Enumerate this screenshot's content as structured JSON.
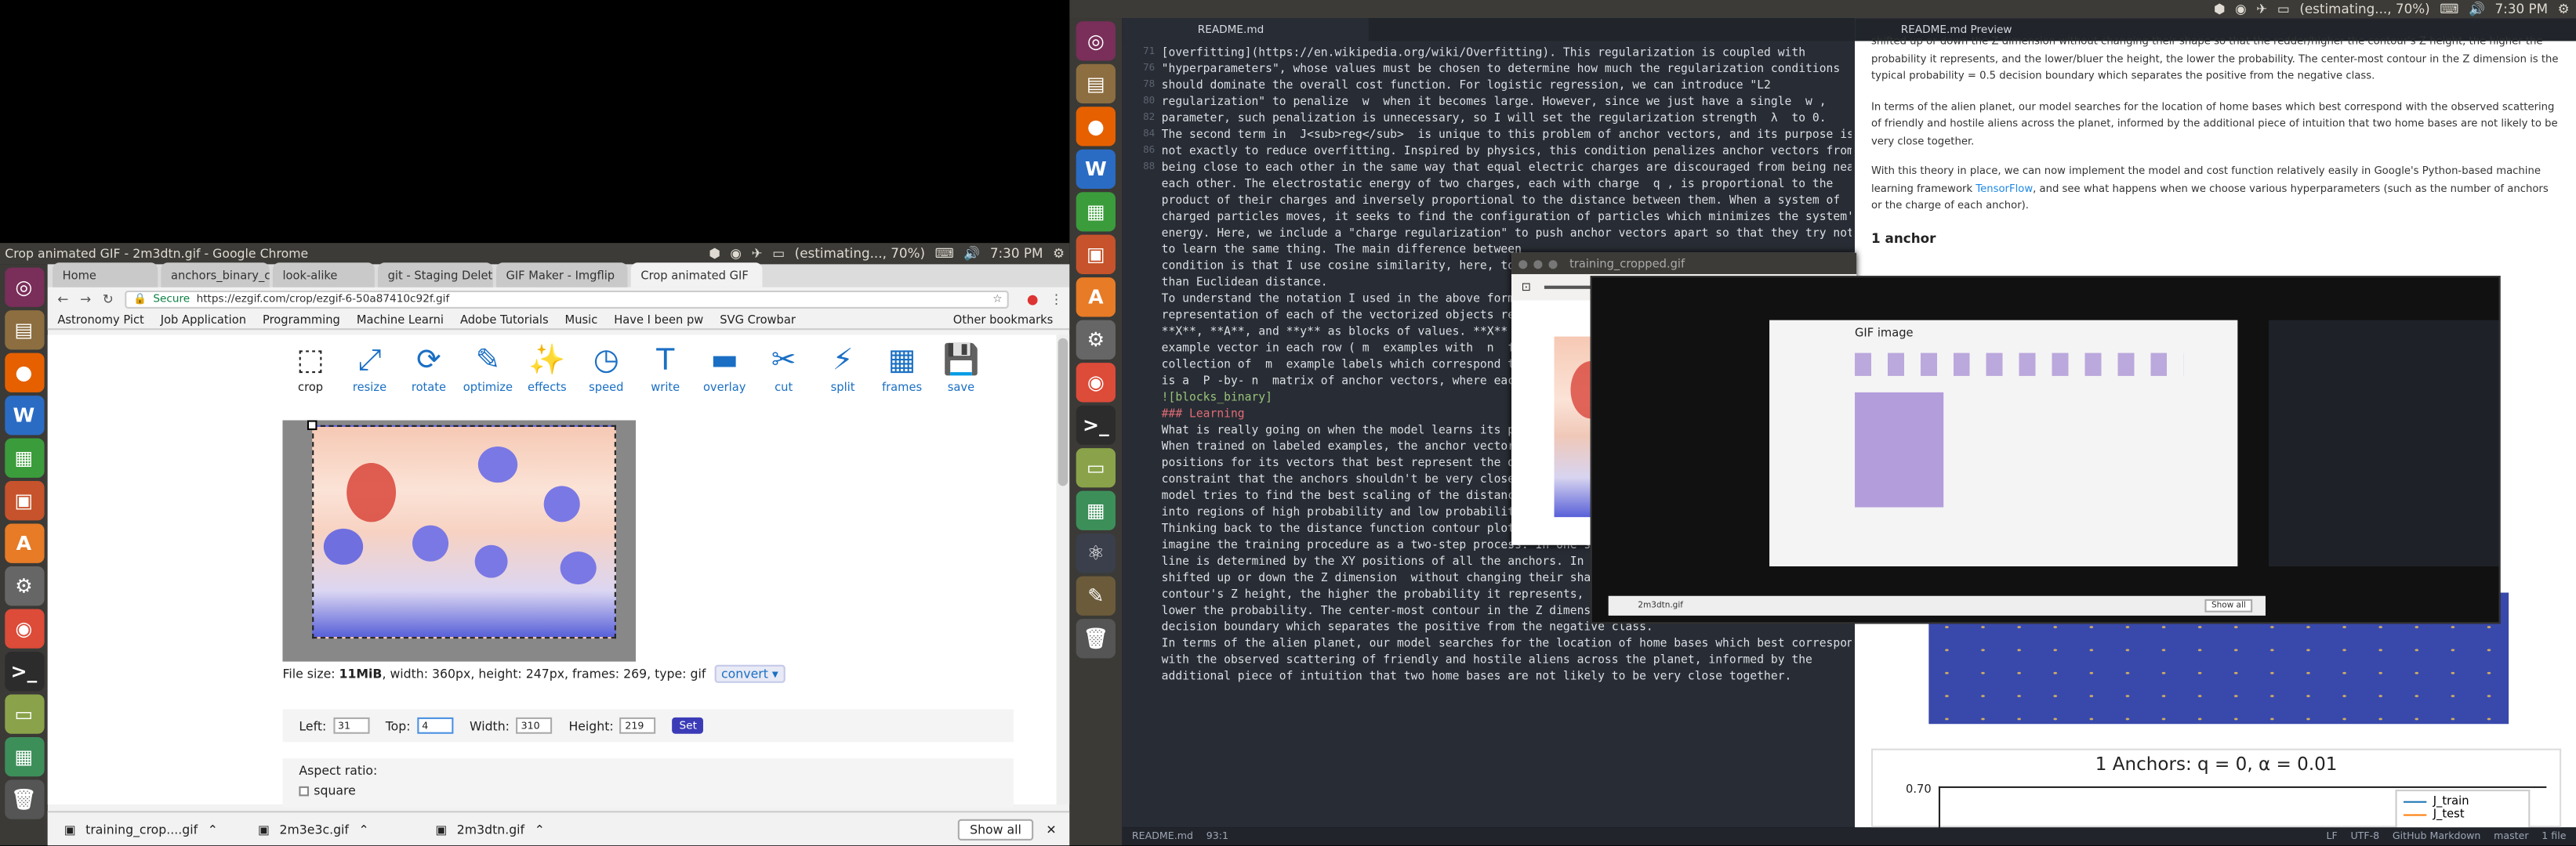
{
  "top_panel_right": {
    "status": "(estimating..., 70%)",
    "time": "7:30 PM"
  },
  "chrome": {
    "title": "Crop animated GIF - 2m3dtn.gif - Google Chrome",
    "tabs": [
      "Home",
      "anchors_binary_cla",
      "look-alike",
      "git - Staging Delete",
      "GIF Maker - Imgflip",
      "Crop animated GIF"
    ],
    "secure": "Secure",
    "url": "https://ezgif.com/crop/ezgif-6-50a87410c92f.gif",
    "bookmarks": [
      "Astronomy Pict",
      "Job Application",
      "Programming",
      "Machine Learni",
      "Adobe Tutorials",
      "Music",
      "Have I been pw",
      "SVG Crowbar",
      "Other bookmarks"
    ],
    "tools": [
      "crop",
      "resize",
      "rotate",
      "optimize",
      "effects",
      "speed",
      "write",
      "overlay",
      "cut",
      "split",
      "frames",
      "save"
    ],
    "file_info_prefix": "File size: ",
    "file_size": "11MiB",
    "file_info_rest": ", width: 360px, height: 247px, frames: 269, type: gif",
    "convert": "convert",
    "form": {
      "left_label": "Left:",
      "left": "31",
      "top_label": "Top:",
      "top": "4",
      "width_label": "Width:",
      "width": "310",
      "height_label": "Height:",
      "height": "219",
      "set": "Set"
    },
    "aspect": "Aspect ratio:",
    "square": "square",
    "downloads": [
      "training_crop....gif",
      "2m3e3c.gif",
      "2m3dtn.gif"
    ],
    "show_all": "Show all"
  },
  "editor": {
    "tab_md": "README.md",
    "tab_preview": "README.md Preview",
    "status_left": "README.md",
    "status_pos": "93:1",
    "status_right": [
      "LF",
      "UTF-8",
      "GitHub Markdown",
      "master",
      "1 file"
    ],
    "line_numbers": [
      "",
      "71",
      "",
      "",
      "",
      "",
      "",
      "",
      "",
      "",
      "76",
      "",
      "",
      "",
      "",
      "",
      "",
      "",
      "",
      "",
      "78",
      "",
      "",
      "",
      "",
      "",
      "",
      "80",
      "",
      "",
      "82",
      "",
      "",
      "84",
      "",
      "",
      "86",
      "",
      "",
      "",
      "",
      "",
      "",
      "",
      "",
      "88",
      "",
      "",
      "",
      "",
      "",
      "",
      "",
      "",
      "90",
      "",
      ""
    ],
    "lines": [
      "[overfitting](https://en.wikipedia.org/wiki/Overfitting). This regularization is coupled with",
      "\"hyperparameters\", whose values must be chosen to determine how much the regularization conditions",
      "should dominate the overall cost function. For logistic regression, we can introduce \"L2",
      "regularization\" to penalize  w  when it becomes large. However, since we just have a single  w ,",
      "parameter, such penalization is unnecessary, so I will set the regularization strength  λ  to 0.",
      "",
      "The second term in  J<sub>reg</sub>  is unique to this problem of anchor vectors, and its purpose is",
      "not exactly to reduce overfitting. Inspired by physics, this condition penalizes anchor vectors from",
      "being close to each other in the same way that equal electric charges are discouraged from being near",
      "each other. The electrostatic energy of two charges, each with charge  q , is proportional to the",
      "product of their charges and inversely proportional to the distance between them. When a system of",
      "charged particles moves, it seeks to find the configuration of particles which minimizes the system's",
      "energy. Here, we include a \"charge regularization\" to push anchor vectors apart so that they try not",
      "to learn the same thing. The main difference between",
      "condition is that I use cosine similarity, here, to",
      "than Euclidean distance.",
      "",
      "To understand the notation I used in the above formul",
      "representation of each of the vectorized objects refe",
      "**X**, **A**, and **y** as blocks of values. **X** is",
      "example vector in each row ( m  examples with  n  fea",
      "collection of  m  example labels which correspond to",
      "is a  P -by- n  matrix of anchor vectors, where each",
      "",
      "![blocks_binary]",
      "",
      "### Learning",
      "",
      "What is really going on when the model learns its par",
      "",
      "When trained on labeled examples, the anchor vector b",
      "positions for its vectors that best represent the distribution of",
      "constraint that the anchors shouldn't be very close together. The",
      "model tries to find the best scaling of the distance function out",
      "into regions of high probability and low probability for positive",
      "",
      "Thinking back to the distance function contour plots shown [above](#Distance Function), we can",
      "imagine the training procedure as a two-step process. In one step, the  shape  of every 2D contour",
      "line is determined by the XY positions of all the anchors. In the other step, the contour lines are",
      "shifted up or down the Z dimension  without changing their shape  so that the redder/higher the",
      "contour's Z height, the higher the probability it represents, and the lower/bluer the height, the",
      "lower the probability. The center-most contour in the Z dimension is the typical probability = 0.5",
      "decision boundary which separates the positive from the negative class.",
      "",
      "In terms of the alien planet, our model searches for the location of home bases which best correspond",
      "with the observed scattering of friendly and hostile aliens across the planet, informed by the",
      "additional piece of intuition that two home bases are not likely to be very close together."
    ],
    "preview_p1": "shifted up or down the Z dimension without changing their shape so that the redder/higher the contour's Z height, the higher the probability it represents, and the lower/bluer the height, the lower the probability. The center-most contour in the Z dimension is the typical probability = 0.5 decision boundary which separates the positive from the negative class.",
    "preview_p2": "In terms of the alien planet, our model searches for the location of home bases which best correspond with the observed scattering of friendly and hostile aliens across the planet, informed by the additional piece of intuition that two home bases are not likely to be very close together.",
    "preview_p3a": "With this theory in place, we can now implement the model and cost function relatively easily in Google's Python-based machine learning framework ",
    "preview_p3_link": "TensorFlow",
    "preview_p3b": ", and see what happens when we choose various hyperparameters (such as the number of anchors or the charge of each anchor).",
    "preview_h": "1 anchor",
    "preview_chart_title": "1 Anchors: q = 0, α = 0.01",
    "preview_chart_ytick": "0.70",
    "preview_legend": [
      "J_train",
      "J_test"
    ]
  },
  "viewer": {
    "title": "training_cropped.gif"
  },
  "nested": {
    "gif_image": "GIF image",
    "file": "2m3dtn.gif",
    "show_all": "Show all"
  },
  "colors": {
    "accent": "#1a6fc4",
    "editor_bg": "#282c34",
    "chrome_tab": "#f2f2f2",
    "launcher": "#3b3a37"
  }
}
